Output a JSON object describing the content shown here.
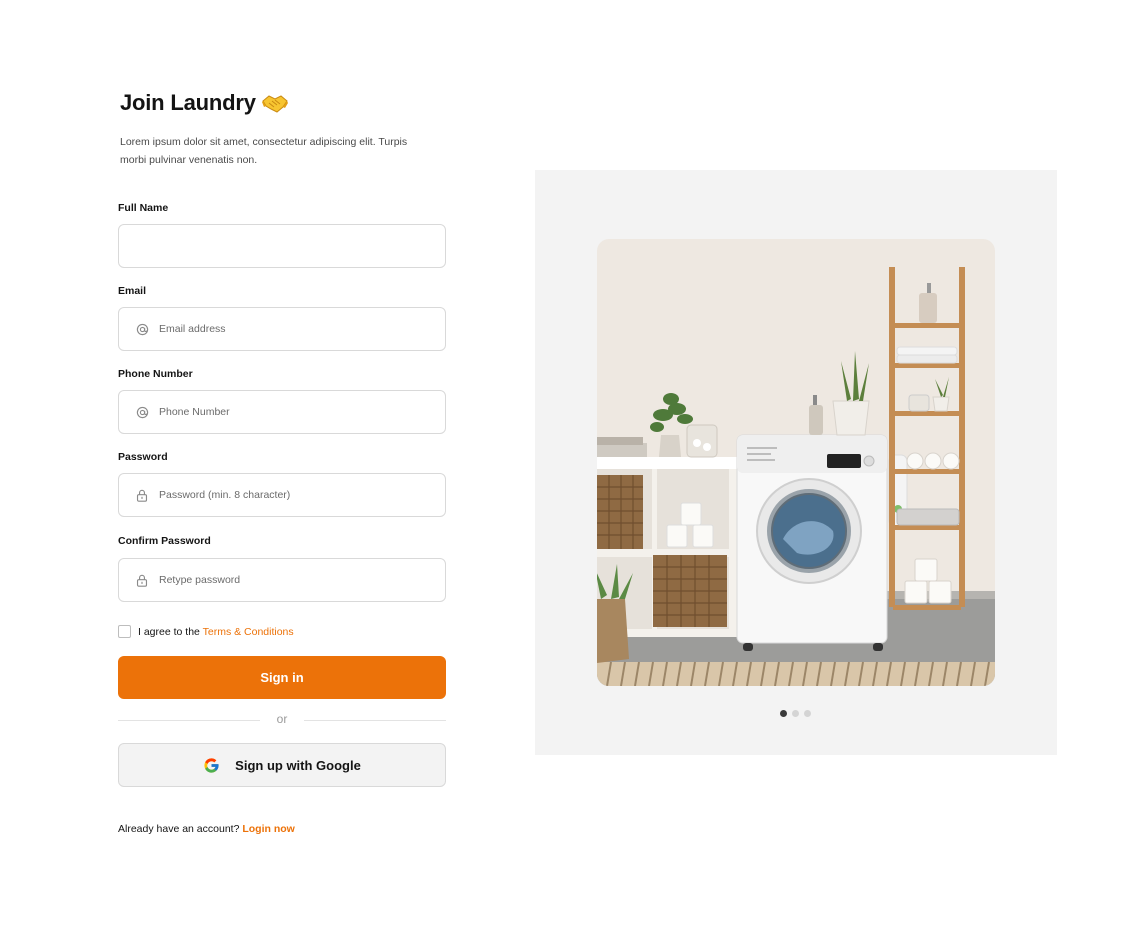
{
  "header": {
    "title": "Join Laundry",
    "subtitle": "Lorem ipsum dolor sit amet, consectetur adipiscing elit. Turpis morbi pulvinar venenatis non."
  },
  "fields": {
    "full_name": {
      "label": "Full Name",
      "value": "",
      "placeholder": ""
    },
    "email": {
      "label": "Email",
      "value": "",
      "placeholder": "Email address",
      "icon": "at-icon"
    },
    "phone": {
      "label": "Phone Number",
      "value": "",
      "placeholder": "Phone Number",
      "icon": "at-icon"
    },
    "password": {
      "label": "Password",
      "value": "",
      "placeholder": "Password (min. 8 character)",
      "icon": "lock-icon"
    },
    "confirm_password": {
      "label": "Confirm Password",
      "value": "",
      "placeholder": "Retype password",
      "icon": "lock-icon"
    }
  },
  "agree": {
    "text": "I agree to the ",
    "link": "Terms & Conditions",
    "checked": false
  },
  "buttons": {
    "signin": "Sign in",
    "divider": "or",
    "google": "Sign up with Google"
  },
  "footer": {
    "text": "Already have an account? ",
    "link": "Login now"
  },
  "carousel": {
    "slide_count": 3,
    "active_index": 0
  },
  "colors": {
    "accent": "#ec7209",
    "panel_bg": "#f3f3f3",
    "border": "#d9d9d9"
  }
}
